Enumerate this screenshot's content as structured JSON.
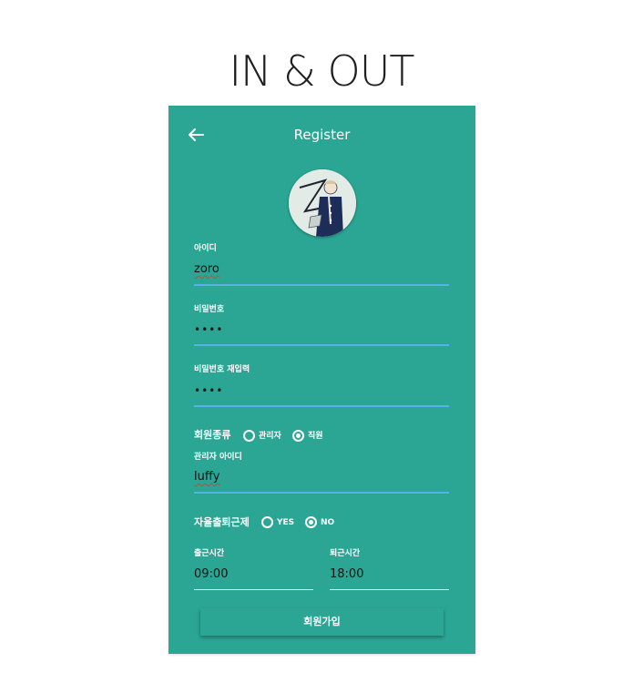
{
  "app_title": "IN & OUT",
  "header": {
    "title": "Register",
    "back_icon": "arrow-left-icon"
  },
  "avatar": {
    "alt": "profile-avatar"
  },
  "fields": {
    "id": {
      "label": "아이디",
      "value": "zoro"
    },
    "password": {
      "label": "비밀번호",
      "value": "••••"
    },
    "password_confirm": {
      "label": "비밀번호 재입력",
      "value": "••••"
    }
  },
  "member_type": {
    "label": "회원종류",
    "options": [
      {
        "label": "관리자",
        "checked": false
      },
      {
        "label": "직원",
        "checked": true
      }
    ]
  },
  "admin_id": {
    "label": "관리자 아이디",
    "value": "luffy"
  },
  "self_checkin": {
    "label": "자율출퇴근제",
    "options": [
      {
        "label": "YES",
        "checked": false
      },
      {
        "label": "NO",
        "checked": true
      }
    ]
  },
  "times": {
    "checkin": {
      "label": "출근시간",
      "value": "09:00"
    },
    "checkout": {
      "label": "퇴근시간",
      "value": "18:00"
    }
  },
  "submit_label": "회원가입",
  "colors": {
    "panel": "#2ba695",
    "focus_underline": "#56b3e8",
    "text": "#ffffff"
  }
}
